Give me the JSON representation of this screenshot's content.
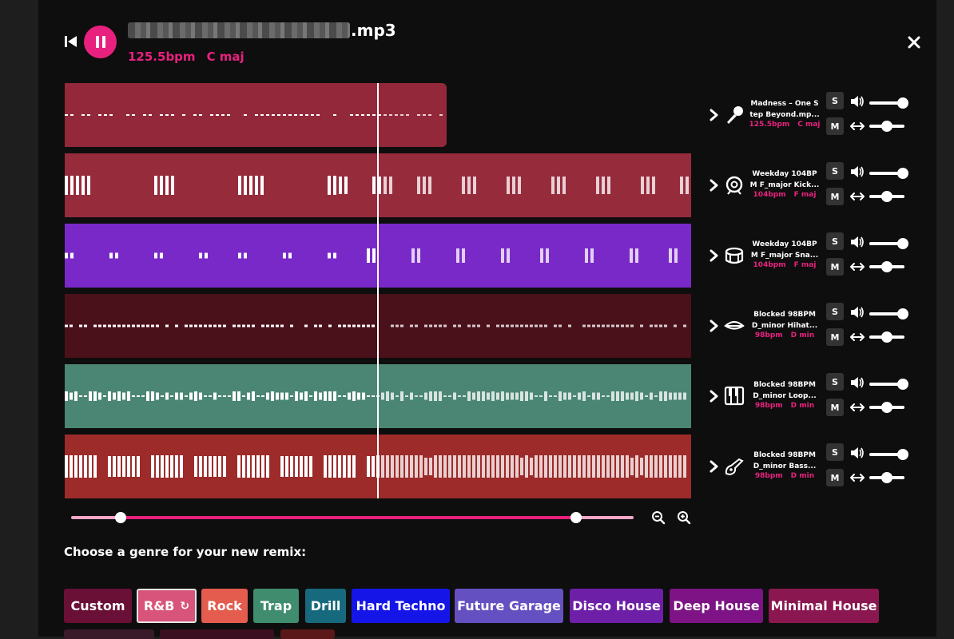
{
  "player": {
    "filename_suffix": ".mp3",
    "bpm": "125.5bpm",
    "key": "C maj",
    "accent": "#e8217e",
    "icons": {
      "previous": "skip-back-icon",
      "pause": "pause-icon",
      "close": "close-icon"
    }
  },
  "tracks": [
    {
      "id": "vocal",
      "color": "#92283a",
      "name_line1": "Madness – One S",
      "name_line2": "tep Beyond.mp...",
      "bpm": "125.5bpm",
      "key": "C maj",
      "icon": "microphone-icon",
      "solo": "S",
      "mute": "M",
      "volume": 0.95,
      "pan": 0.5
    },
    {
      "id": "kick",
      "color": "#962b3c",
      "name_line1": "Weekday 104BP",
      "name_line2": "M F_major Kick...",
      "bpm": "104bpm",
      "key": "F maj",
      "icon": "kick-drum-icon",
      "solo": "S",
      "mute": "M",
      "volume": 0.95,
      "pan": 0.5
    },
    {
      "id": "snare",
      "color": "#7a29c9",
      "name_line1": "Weekday 104BP",
      "name_line2": "M F_major Sna...",
      "bpm": "104bpm",
      "key": "F maj",
      "icon": "snare-drum-icon",
      "solo": "S",
      "mute": "M",
      "volume": 0.95,
      "pan": 0.5
    },
    {
      "id": "hihat",
      "color": "#4b111b",
      "name_line1": "Blocked 98BPM",
      "name_line2": "D_minor Hihat...",
      "bpm": "98bpm",
      "key": "D min",
      "icon": "hihat-icon",
      "solo": "S",
      "mute": "M",
      "volume": 0.95,
      "pan": 0.5
    },
    {
      "id": "loop",
      "color": "#4a8673",
      "name_line1": "Blocked 98BPM",
      "name_line2": "D_minor Loop...",
      "bpm": "98bpm",
      "key": "D min",
      "icon": "piano-icon",
      "solo": "S",
      "mute": "M",
      "volume": 0.95,
      "pan": 0.5
    },
    {
      "id": "bass",
      "color": "#9c2b2a",
      "name_line1": "Blocked 98BPM",
      "name_line2": "D_minor Bass...",
      "bpm": "98bpm",
      "key": "D min",
      "icon": "bass-guitar-icon",
      "solo": "S",
      "mute": "M",
      "volume": 0.95,
      "pan": 0.5
    }
  ],
  "zoom": {
    "start": 0.087,
    "end": 0.898,
    "icons": [
      "zoom-out-icon",
      "zoom-in-icon"
    ]
  },
  "genre": {
    "label": "Choose a genre for your new remix:",
    "options": [
      {
        "label": "Custom",
        "color": "#6a0f36",
        "selected": false
      },
      {
        "label": "R&B",
        "color": "#d9547a",
        "selected": true
      },
      {
        "label": "Rock",
        "color": "#e35c4e",
        "selected": false
      },
      {
        "label": "Trap",
        "color": "#3f8c6f",
        "selected": false
      },
      {
        "label": "Drill",
        "color": "#17697e",
        "selected": false
      },
      {
        "label": "Hard Techno",
        "color": "#1515e8",
        "selected": false
      },
      {
        "label": "Future Garage",
        "color": "#6550c1",
        "selected": false
      },
      {
        "label": "Disco House",
        "color": "#6e1fa8",
        "selected": false
      },
      {
        "label": "Deep House",
        "color": "#7d1384",
        "selected": false
      },
      {
        "label": "Minimal House",
        "color": "#8b1750",
        "selected": false
      }
    ],
    "refresh_icon": "refresh-icon"
  }
}
